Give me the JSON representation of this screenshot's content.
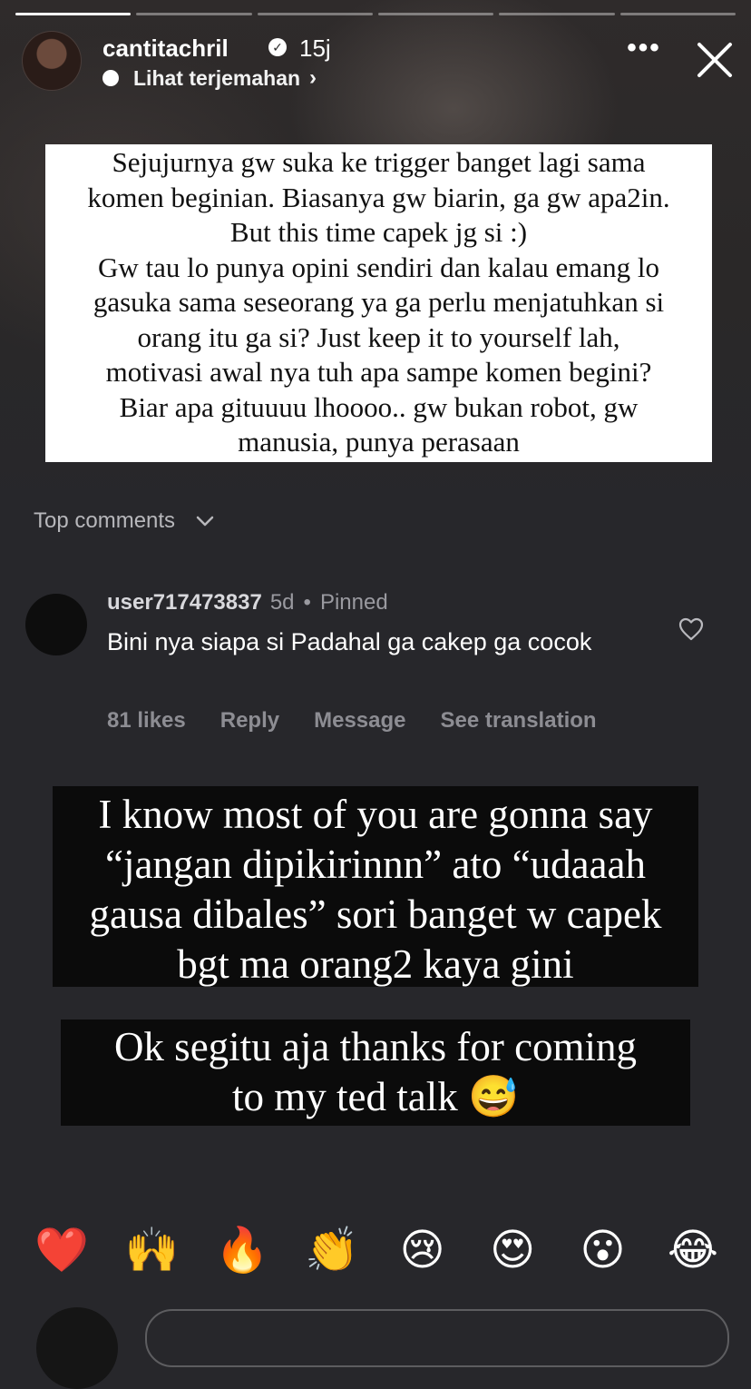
{
  "story": {
    "progress_segments": [
      1.0,
      0,
      0,
      0,
      0,
      0
    ]
  },
  "header": {
    "username": "cantitachril",
    "time": "15j",
    "translate_label": "Lihat terjemahan",
    "verified_icon": "verified-check-icon",
    "more_icon": "more-dots-icon",
    "close_icon": "close-icon"
  },
  "white_card": {
    "lines": [
      "Sejujurnya gw suka ke trigger banget lagi sama",
      "komen beginian. Biasanya gw biarin, ga gw apa2in.",
      "But this time capek jg si :)",
      "Gw tau lo punya opini sendiri dan kalau emang lo",
      "gasuka sama seseorang ya ga perlu menjatuhkan si",
      "orang itu ga si? Just keep it to yourself lah,",
      "motivasi awal nya tuh apa sampe komen begini?",
      "Biar apa gituuuu lhoooo.. gw bukan robot, gw",
      "manusia, punya perasaan"
    ]
  },
  "comments_section": {
    "title": "Top comments",
    "comment": {
      "username": "user717473837",
      "time": "5d",
      "separator": "•",
      "pinned": "Pinned",
      "text": "Bini nya siapa si Padahal ga cakep ga cocok",
      "likes": "81 likes",
      "reply": "Reply",
      "message": "Message",
      "see_translation": "See translation"
    }
  },
  "black_card_1": {
    "lines": [
      "I know most of you are gonna say",
      "“jangan dipikirinnn” ato “udaaah",
      "gausa dibales” sori banget w capek",
      "bgt ma orang2 kaya gini"
    ]
  },
  "black_card_2": {
    "lines": [
      "Ok segitu aja thanks for coming",
      "to my ted talk 😅"
    ]
  },
  "reactions": [
    "❤️",
    "🙌",
    "🔥",
    "👏",
    "😢",
    "😍",
    "😮",
    "😂"
  ]
}
